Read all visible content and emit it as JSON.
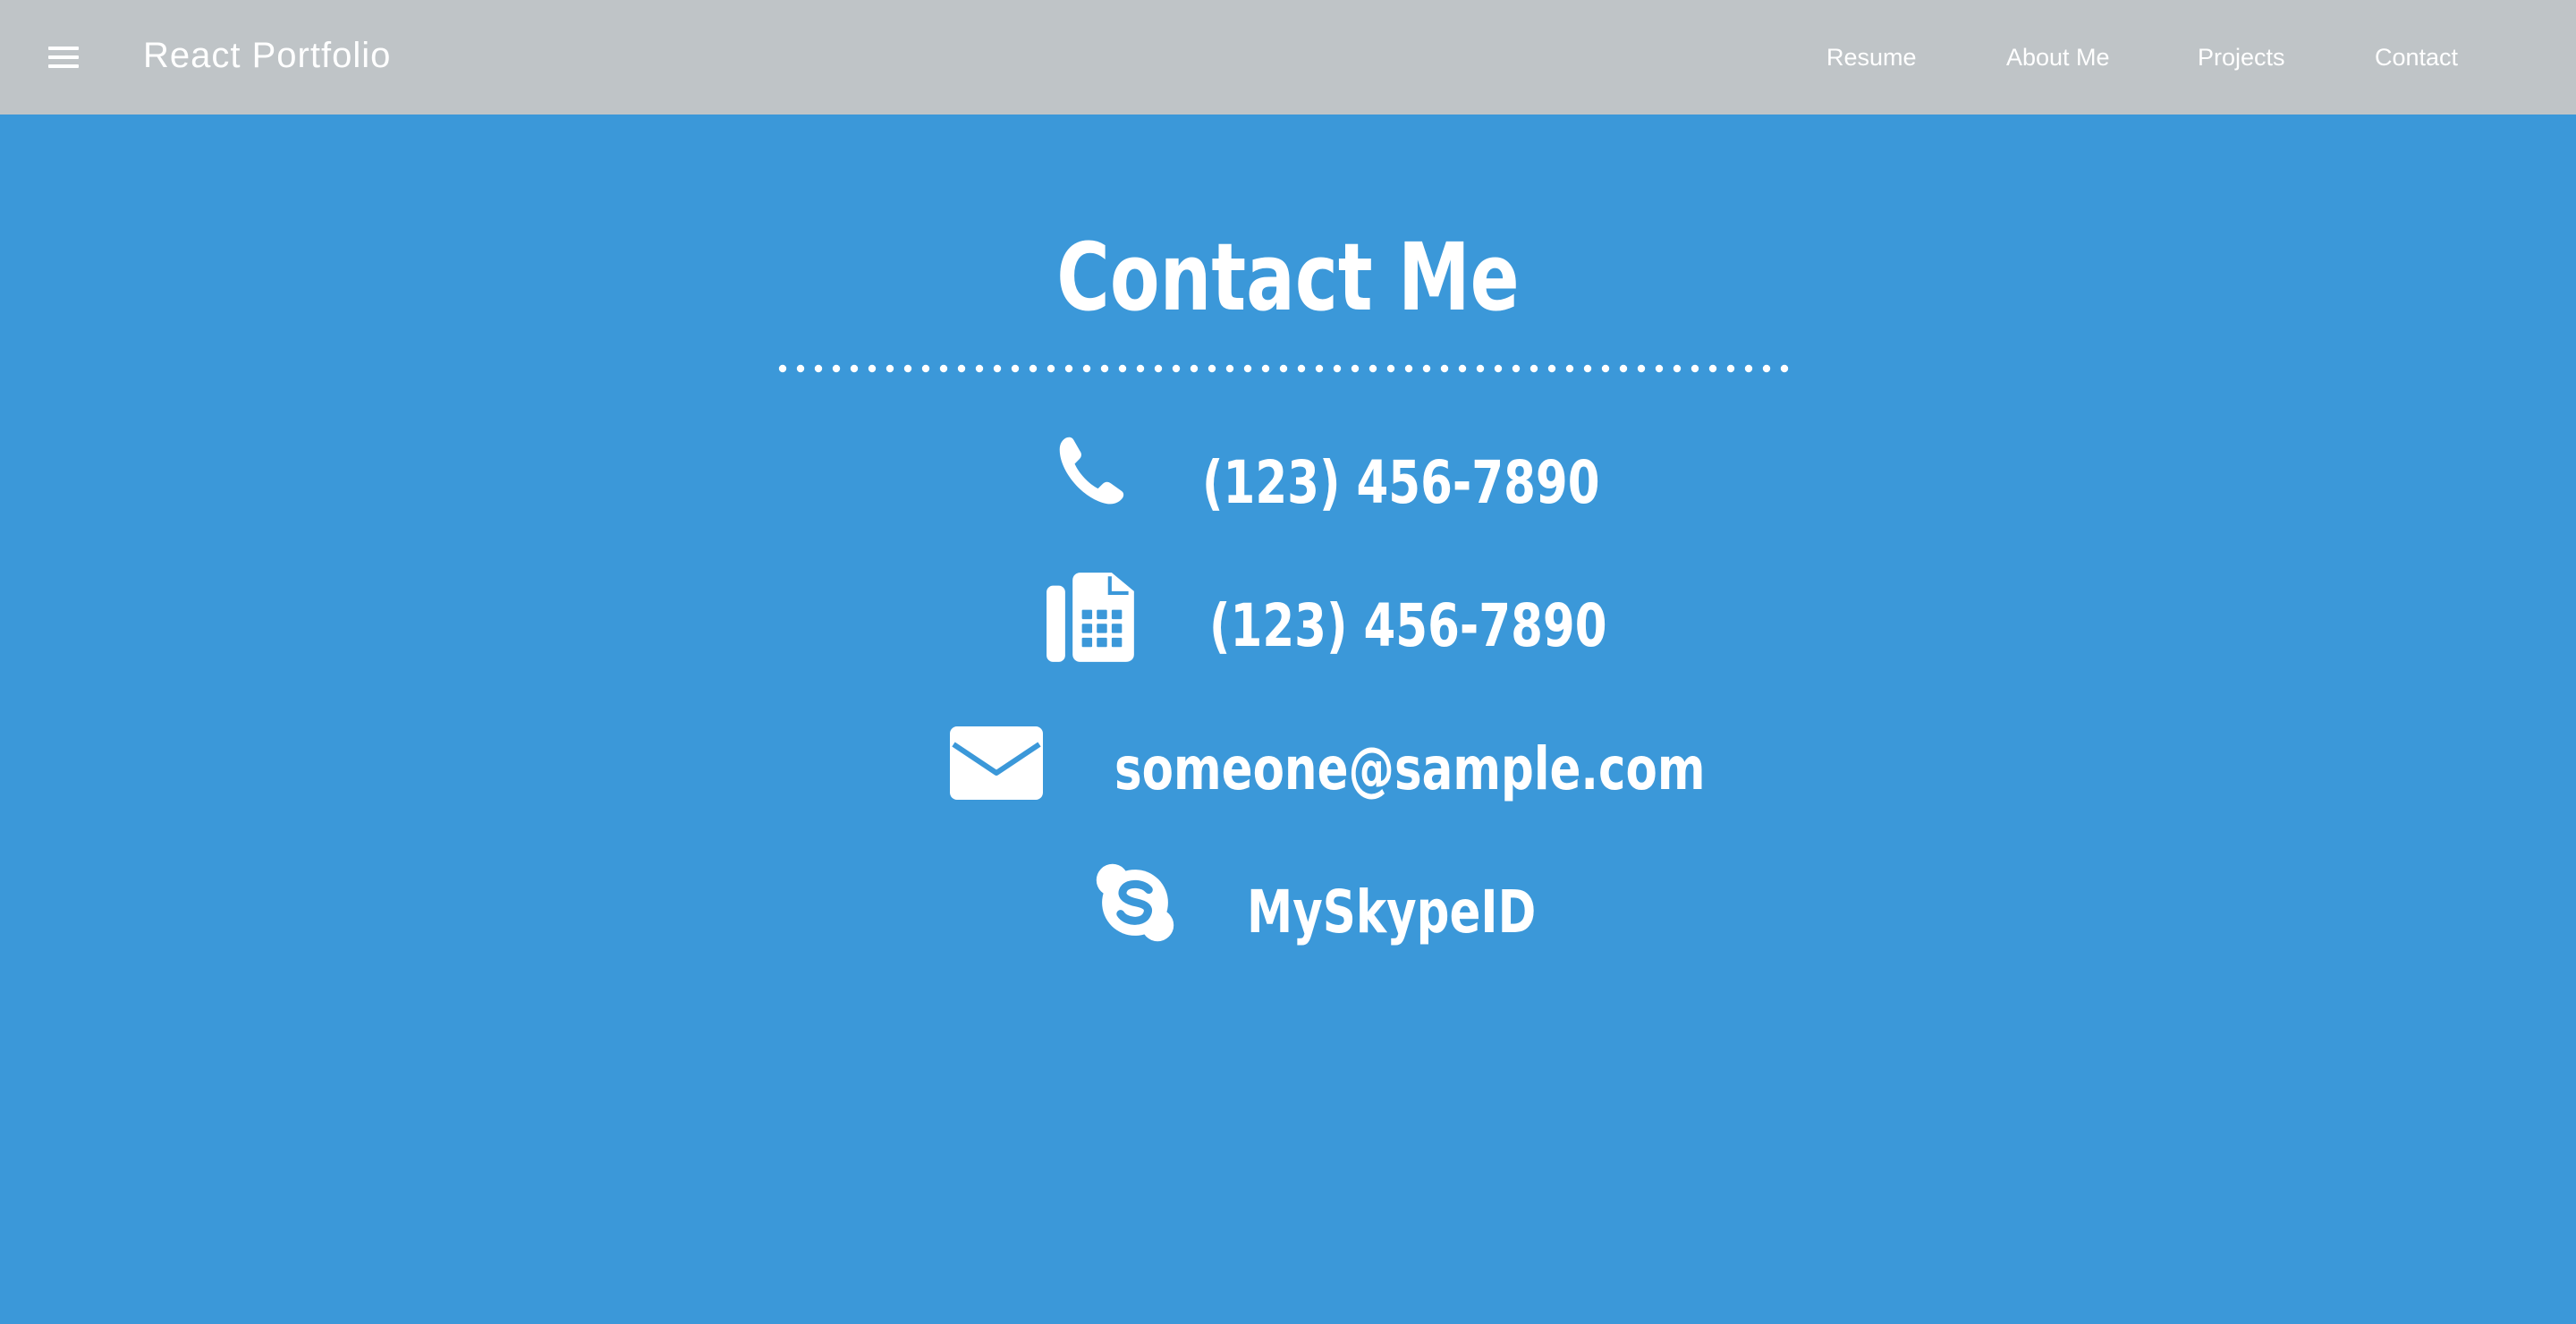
{
  "header": {
    "app_title": "React Portfolio",
    "menu_icon": "hamburger-menu-icon",
    "nav": [
      {
        "label": "Resume"
      },
      {
        "label": "About Me"
      },
      {
        "label": "Projects"
      },
      {
        "label": "Contact"
      }
    ]
  },
  "main": {
    "title": "Contact Me",
    "contacts": [
      {
        "icon": "phone-icon",
        "value": "(123) 456-7890"
      },
      {
        "icon": "fax-icon",
        "value": "(123) 456-7890"
      },
      {
        "icon": "envelope-icon",
        "value": "someone@sample.com"
      },
      {
        "icon": "skype-icon",
        "value": "MySkypeID"
      }
    ]
  },
  "colors": {
    "background": "#3b98d9",
    "header": "#bfc4c7",
    "text": "#ffffff"
  }
}
